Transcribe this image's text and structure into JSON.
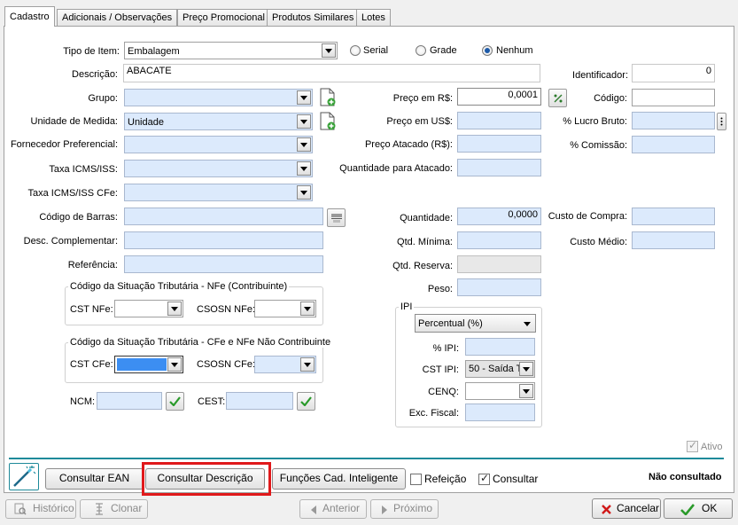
{
  "tabs": [
    "Cadastro",
    "Adicionais / Observações",
    "Preço Promocional",
    "Produtos Similares",
    "Lotes"
  ],
  "form": {
    "tipo_item_label": "Tipo de Item:",
    "tipo_item_value": "Embalagem",
    "radio_serial": "Serial",
    "radio_grade": "Grade",
    "radio_nenhum": "Nenhum",
    "radio_selected": "Nenhum",
    "descricao_label": "Descrição:",
    "descricao_value": "ABACATE",
    "identificador_label": "Identificador:",
    "identificador_value": "0",
    "grupo_label": "Grupo:",
    "grupo_value": "",
    "unidade_label": "Unidade de Medida:",
    "unidade_value": "Unidade",
    "fornecedor_label": "Fornecedor Preferencial:",
    "taxa_icms_label": "Taxa ICMS/ISS:",
    "taxa_icms_cfe_label": "Taxa ICMS/ISS CFe:",
    "codigo_barras_label": "Código de Barras:",
    "desc_complementar_label": "Desc. Complementar:",
    "referencia_label": "Referência:",
    "preco_rs_label": "Preço em R$:",
    "preco_rs_value": "0,0001",
    "preco_us_label": "Preço em US$:",
    "preco_atacado_label": "Preço Atacado (R$):",
    "qtd_atacado_label": "Quantidade para Atacado:",
    "codigo_label": "Código:",
    "lucro_bruto_label": "% Lucro Bruto:",
    "comissao_label": "% Comissão:",
    "quantidade_label": "Quantidade:",
    "quantidade_value": "0,0000",
    "qtd_minima_label": "Qtd. Mínima:",
    "qtd_reserva_label": "Qtd. Reserva:",
    "peso_label": "Peso:",
    "custo_compra_label": "Custo de Compra:",
    "custo_medio_label": "Custo Médio:",
    "cst_nfe_group": "Código da Situação Tributária - NFe (Contribuinte)",
    "cst_nfe_label": "CST NFe:",
    "csosn_nfe_label": "CSOSN NFe:",
    "cst_cfe_group": "Código da Situação Tributária - CFe e NFe Não Contribuinte",
    "cst_cfe_label": "CST CFe:",
    "csosn_cfe_label": "CSOSN CFe:",
    "ncm_label": "NCM:",
    "cest_label": "CEST:",
    "ipi_group": "IPI",
    "ipi_tipo_value": "Percentual (%)",
    "ipi_pct_label": "% IPI:",
    "cst_ipi_label": "CST IPI:",
    "cst_ipi_value": "50 - Saída T",
    "cenq_label": "CENQ:",
    "exc_fiscal_label": "Exc. Fiscal:",
    "ativo_label": "Ativo",
    "ativo_checked": true
  },
  "action_bar": {
    "consultar_ean": "Consultar EAN",
    "consultar_descricao": "Consultar Descrição",
    "funcoes_cad": "Funções Cad. Inteligente",
    "refeicao_label": "Refeição",
    "refeicao_checked": false,
    "consultar_label": "Consultar",
    "consultar_checked": true,
    "status": "Não consultado"
  },
  "footer": {
    "historico": "Histórico",
    "clonar": "Clonar",
    "anterior": "Anterior",
    "proximo": "Próximo",
    "cancelar": "Cancelar",
    "ok": "OK"
  },
  "colors": {
    "field_bg": "#dceafc",
    "highlight_border": "#e0191b",
    "accent_line": "#1e8a9a",
    "selected_combo": "#3c8ef2"
  }
}
